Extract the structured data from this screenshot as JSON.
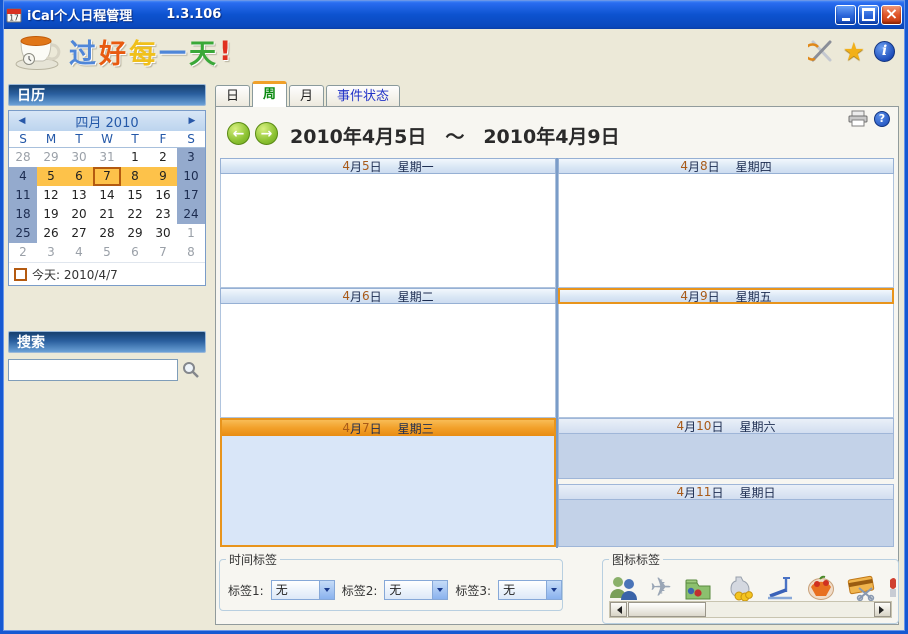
{
  "window": {
    "title": "iCal个人日程管理",
    "version": "1.3.106"
  },
  "header": {
    "slogan_text": "过好每一天!",
    "slogan": [
      {
        "ch": "过",
        "color": "#4f86d8"
      },
      {
        "ch": "好",
        "color": "#e85a10"
      },
      {
        "ch": "每",
        "color": "#f0c01c"
      },
      {
        "ch": "一",
        "color": "#4f86d8"
      },
      {
        "ch": "天",
        "color": "#3aa838"
      },
      {
        "ch": "!",
        "color": "#e03020"
      }
    ]
  },
  "sidebar": {
    "calendar_section_title": "日历",
    "search_section_title": "搜索",
    "mini_calendar": {
      "month_label": "四月 2010",
      "weekdays": [
        "S",
        "M",
        "T",
        "W",
        "T",
        "F",
        "S"
      ],
      "cells": [
        {
          "t": "28",
          "s": "dim"
        },
        {
          "t": "29",
          "s": "dim"
        },
        {
          "t": "30",
          "s": "dim"
        },
        {
          "t": "31",
          "s": "dim"
        },
        {
          "t": "1",
          "s": ""
        },
        {
          "t": "2",
          "s": ""
        },
        {
          "t": "3",
          "s": "we"
        },
        {
          "t": "4",
          "s": "we"
        },
        {
          "t": "5",
          "s": "cw"
        },
        {
          "t": "6",
          "s": "cw"
        },
        {
          "t": "7",
          "s": "today"
        },
        {
          "t": "8",
          "s": "cw"
        },
        {
          "t": "9",
          "s": "cw"
        },
        {
          "t": "10",
          "s": "we"
        },
        {
          "t": "11",
          "s": "we"
        },
        {
          "t": "12",
          "s": ""
        },
        {
          "t": "13",
          "s": ""
        },
        {
          "t": "14",
          "s": ""
        },
        {
          "t": "15",
          "s": ""
        },
        {
          "t": "16",
          "s": ""
        },
        {
          "t": "17",
          "s": "we"
        },
        {
          "t": "18",
          "s": "we"
        },
        {
          "t": "19",
          "s": ""
        },
        {
          "t": "20",
          "s": ""
        },
        {
          "t": "21",
          "s": ""
        },
        {
          "t": "22",
          "s": ""
        },
        {
          "t": "23",
          "s": ""
        },
        {
          "t": "24",
          "s": "we"
        },
        {
          "t": "25",
          "s": "we"
        },
        {
          "t": "26",
          "s": ""
        },
        {
          "t": "27",
          "s": ""
        },
        {
          "t": "28",
          "s": ""
        },
        {
          "t": "29",
          "s": ""
        },
        {
          "t": "30",
          "s": ""
        },
        {
          "t": "1",
          "s": "dim"
        },
        {
          "t": "2",
          "s": "dim"
        },
        {
          "t": "3",
          "s": "dim"
        },
        {
          "t": "4",
          "s": "dim"
        },
        {
          "t": "5",
          "s": "dim"
        },
        {
          "t": "6",
          "s": "dim"
        },
        {
          "t": "7",
          "s": "dim"
        },
        {
          "t": "8",
          "s": "dim"
        }
      ],
      "today_label": "今天: 2010/4/7"
    },
    "search": {
      "value": ""
    }
  },
  "main": {
    "tabs": [
      {
        "label": "日"
      },
      {
        "label": "周"
      },
      {
        "label": "月"
      },
      {
        "label": "事件状态"
      }
    ],
    "toolbar": {
      "range_title": "2010年4月5日　～　2010年4月9日"
    },
    "chars": {
      "month": "月",
      "day": "日"
    },
    "day_cells": [
      {
        "m": "4",
        "d": "5",
        "weekday": "星期一"
      },
      {
        "m": "4",
        "d": "6",
        "weekday": "星期二"
      },
      {
        "m": "4",
        "d": "7",
        "weekday": "星期三"
      },
      {
        "m": "4",
        "d": "8",
        "weekday": "星期四"
      },
      {
        "m": "4",
        "d": "9",
        "weekday": "星期五"
      },
      {
        "m": "4",
        "d": "10",
        "weekday": "星期六"
      },
      {
        "m": "4",
        "d": "11",
        "weekday": "星期日"
      }
    ],
    "time_tags": {
      "legend": "时间标签",
      "items": [
        {
          "label": "标签1:",
          "value": "无"
        },
        {
          "label": "标签2:",
          "value": "无"
        },
        {
          "label": "标签3:",
          "value": "无"
        }
      ]
    },
    "icon_tags": {
      "legend": "图标标签",
      "items": [
        "meeting-people",
        "airplane",
        "work-folder",
        "money-bag",
        "treadmill",
        "food-plate",
        "bank-card",
        "partial"
      ]
    }
  },
  "colors": {
    "week_highlight": "#fdc24a",
    "today_border": "#b45a10",
    "selected_border": "#e8941c",
    "weekend_bg": "#94aacd",
    "titlebar_blue": "#0d53d0",
    "active_tab_text": "#0a8a10"
  }
}
